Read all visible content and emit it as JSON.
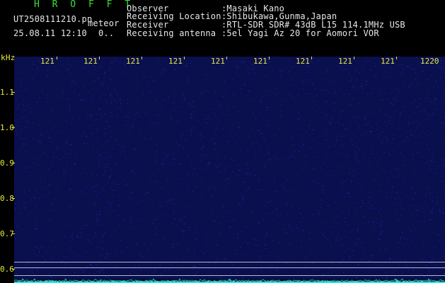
{
  "header": {
    "logo": "H R O F F T",
    "filename": "UT2508111210.pn",
    "detect_label": "meteor",
    "datetime": "25.08.11 12:10",
    "count": "0..",
    "info": [
      {
        "label": "Observer",
        "value": ":Masaki Kano"
      },
      {
        "label": "Receiving Location",
        "value": ":Shibukawa,Gunma,Japan"
      },
      {
        "label": "Receiver",
        "value": ":RTL-SDR SDR# 43dB L15 114.1MHz USB"
      },
      {
        "label": "Receiving antenna",
        "value": ":5el Yagi Az 20 for Aomori VOR"
      }
    ]
  },
  "plot": {
    "y_unit": "kHz",
    "y_ticks": [
      "1.1",
      "1.0",
      "0.9",
      "0.8",
      "0.7",
      "0.6"
    ],
    "x_ticks": [
      "121",
      "121",
      "121",
      "121",
      "121",
      "121",
      "121",
      "121",
      "121",
      "1220"
    ],
    "colors": {
      "background": "#0a0f4e",
      "noise": "#2a35c0",
      "spectrum": "#2ee6f0",
      "axis_labels": "#e8e843"
    }
  }
}
